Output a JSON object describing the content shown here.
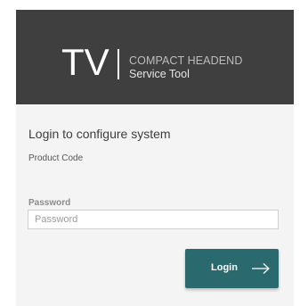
{
  "header": {
    "logo": "TV",
    "brand_line1": "COMPACT HEADEND",
    "brand_line2": "Service Tool"
  },
  "form": {
    "title": "Login to configure system",
    "product_code_label": "Product Code",
    "password_label": "Password",
    "password_placeholder": "Password",
    "password_value": "",
    "login_label": "Login",
    "login_icon": "arrow-right-icon"
  },
  "colors": {
    "header_bg": "#3f3f3f",
    "panel_bg": "#f4f4f4",
    "button_bg": "#2a6a6f"
  }
}
